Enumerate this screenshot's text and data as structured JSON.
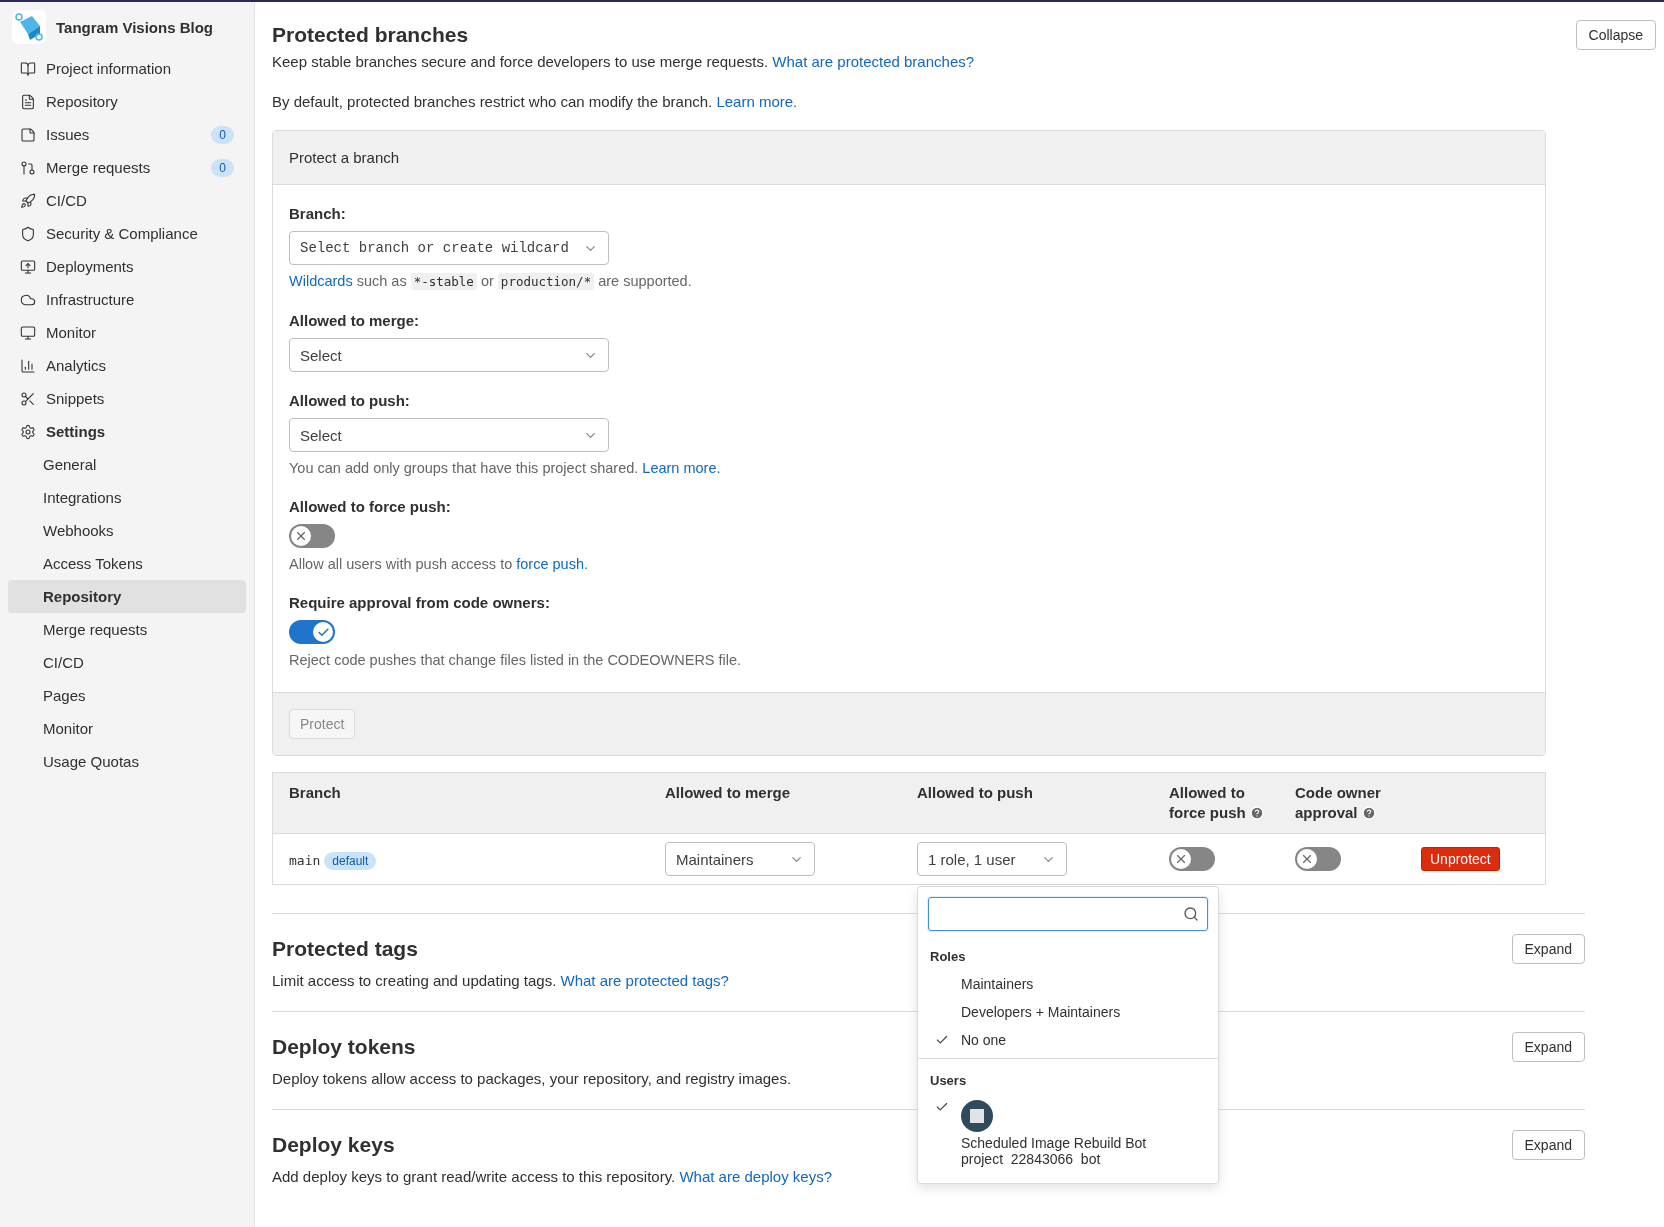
{
  "sidebar": {
    "project": "Tangram Visions Blog",
    "items": [
      {
        "label": "Project information",
        "selected": false
      },
      {
        "label": "Repository",
        "selected": false
      },
      {
        "label": "Issues",
        "badge": "0",
        "selected": false
      },
      {
        "label": "Merge requests",
        "badge": "0",
        "selected": false
      },
      {
        "label": "CI/CD",
        "selected": false
      },
      {
        "label": "Security & Compliance",
        "selected": false
      },
      {
        "label": "Deployments",
        "selected": false
      },
      {
        "label": "Infrastructure",
        "selected": false
      },
      {
        "label": "Monitor",
        "selected": false
      },
      {
        "label": "Analytics",
        "selected": false
      },
      {
        "label": "Snippets",
        "selected": false
      },
      {
        "label": "Settings",
        "selected": true,
        "children": [
          {
            "label": "General",
            "selected": false
          },
          {
            "label": "Integrations",
            "selected": false
          },
          {
            "label": "Webhooks",
            "selected": false
          },
          {
            "label": "Access Tokens",
            "selected": false
          },
          {
            "label": "Repository",
            "selected": true
          },
          {
            "label": "Merge requests",
            "selected": false
          },
          {
            "label": "CI/CD",
            "selected": false
          },
          {
            "label": "Pages",
            "selected": false
          },
          {
            "label": "Monitor",
            "selected": false
          },
          {
            "label": "Usage Quotas",
            "selected": false
          }
        ]
      }
    ]
  },
  "protected_branches": {
    "title": "Protected branches",
    "button": "Collapse",
    "description": {
      "text": "Keep stable branches secure and force developers to use merge requests. ",
      "link": "What are protected branches?"
    },
    "note": {
      "text": "By default, protected branches restrict who can modify the branch. ",
      "link": "Learn more."
    },
    "form": {
      "header": "Protect a branch",
      "branch": {
        "label": "Branch:",
        "placeholder": "Select branch or create wildcard",
        "hint": [
          {
            "kind": "link",
            "text": "Wildcards"
          },
          {
            "kind": "text",
            "text": " such as "
          },
          {
            "kind": "code",
            "text": "*-stable"
          },
          {
            "kind": "text",
            "text": " or "
          },
          {
            "kind": "code",
            "text": "production/*"
          },
          {
            "kind": "text",
            "text": " are supported."
          }
        ]
      },
      "merge": {
        "label": "Allowed to merge:",
        "placeholder": "Select"
      },
      "push": {
        "label": "Allowed to push:",
        "placeholder": "Select",
        "hint": "You can add only groups that have this project shared. ",
        "link": "Learn more."
      },
      "force_push": {
        "label": "Allowed to force push:",
        "on": false,
        "hint": "Allow all users with push access to ",
        "link": "force push."
      },
      "code_owners": {
        "label": "Require approval from code owners:",
        "on": true,
        "hint": "Reject code pushes that change files listed in the CODEOWNERS file."
      },
      "submit": {
        "label": "Protect",
        "disabled": true
      }
    },
    "table": {
      "columns": [
        {
          "label": "Branch",
          "help": false
        },
        {
          "label": "Allowed to merge",
          "help": false
        },
        {
          "label": "Allowed to push",
          "help": false
        },
        {
          "label": "Allowed to force push",
          "help": true
        },
        {
          "label": "Code owner approval",
          "help": true
        }
      ],
      "rows": [
        {
          "branch": "main",
          "badge": "default",
          "merge": "Maintainers",
          "push": "1 role, 1 user",
          "force_push": false,
          "code_owner": false,
          "action": "Unprotect"
        }
      ]
    },
    "dropdown": {
      "sections": [
        {
          "title": "Roles",
          "items": [
            {
              "label": "Maintainers",
              "selected": false
            },
            {
              "label": "Developers + Maintainers",
              "selected": false
            },
            {
              "label": "No one",
              "selected": true
            }
          ]
        },
        {
          "title": "Users",
          "items": [
            {
              "label": "Scheduled Image Rebuild Bot",
              "username": "project  22843066  bot",
              "selected": true
            }
          ]
        }
      ]
    }
  },
  "sections": [
    {
      "title": "Protected tags",
      "text": "Limit access to creating and updating tags. ",
      "link": "What are protected tags?",
      "button": "Expand"
    },
    {
      "title": "Deploy tokens",
      "text": "Deploy tokens allow access to packages, your repository, and registry images.",
      "button": "Expand"
    },
    {
      "title": "Deploy keys",
      "text": "Add deploy keys to grant read/write access to this repository. ",
      "link": "What are deploy keys?",
      "button": "Expand"
    }
  ]
}
